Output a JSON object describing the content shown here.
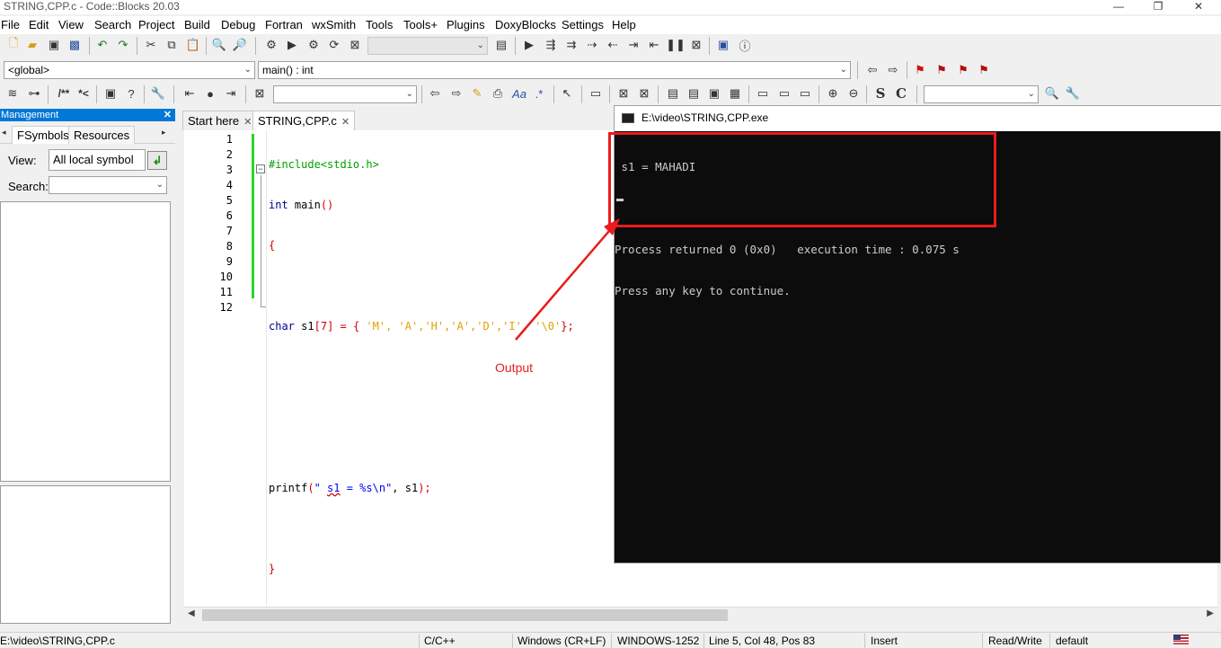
{
  "window": {
    "title": "STRING,CPP.c - Code::Blocks 20.03",
    "controls": [
      "—",
      "❐",
      "✕"
    ]
  },
  "menu": [
    "File",
    "Edit",
    "View",
    "Search",
    "Project",
    "Build",
    "Debug",
    "Fortran",
    "wxSmith",
    "Tools",
    "Tools+",
    "Plugins",
    "DoxyBlocks",
    "Settings",
    "Help"
  ],
  "toolbar": {
    "scope_combo": "<global>",
    "function_combo": "main() : int",
    "doxy_comment": "/**",
    "doxy_inline": "*<",
    "search_glyph_case": "S",
    "search_glyph_regex": "C",
    "regex_glyph": ".*",
    "font_glyph": "Aa"
  },
  "management": {
    "title": "Management",
    "tabs": [
      "FSymbols",
      "Resources"
    ],
    "view_label": "View:",
    "view_value": "All local symbol",
    "search_label": "Search:"
  },
  "editor": {
    "tabs": [
      "Start here",
      "STRING,CPP.c"
    ],
    "active_tab": "STRING,CPP.c",
    "line_numbers": [
      "1",
      "2",
      "3",
      "4",
      "5",
      "6",
      "7",
      "8",
      "9",
      "10",
      "11",
      "12"
    ]
  },
  "code": {
    "l1": "#include<stdio.h>",
    "l2_kw": "int",
    "l2_rest": " main",
    "l2_paren": "()",
    "l3": "{",
    "l5_kw": "char",
    "l5_var": " s1",
    "l5_b1": "[",
    "l5_num": "7",
    "l5_b2": "]",
    "l5_eq": " = {",
    "l5_c1": " 'M'",
    "l5_c2": ", 'A'",
    "l5_c3": ",'H'",
    "l5_c4": ",'A'",
    "l5_c5": ",'D'",
    "l5_c6": ",'I'",
    "l5_c7": ", '\\0'",
    "l5_end": "};",
    "l9_fn": "printf",
    "l9_p1": "(",
    "l9_str1": "\" ",
    "l9_sq": "s1",
    "l9_str2": " = %s\\n\"",
    "l9_rest": ", s1",
    "l9_p2": ");",
    "l11": "}"
  },
  "console": {
    "title": "E:\\video\\STRING,CPP.exe",
    "line1": " s1 = MAHADI",
    "line2": "",
    "line3": "Process returned 0 (0x0)   execution time : 0.075 s",
    "line4": "Press any key to continue."
  },
  "annotation": {
    "label": "Output",
    "color": "#e81c1c"
  },
  "statusbar": {
    "path": "E:\\video\\STRING,CPP.c",
    "language": "C/C++",
    "eol": "Windows (CR+LF)",
    "encoding": "WINDOWS-1252",
    "position": "Line 5, Col 48, Pos 83",
    "mode": "Insert",
    "access": "Read/Write",
    "profile": "default"
  }
}
